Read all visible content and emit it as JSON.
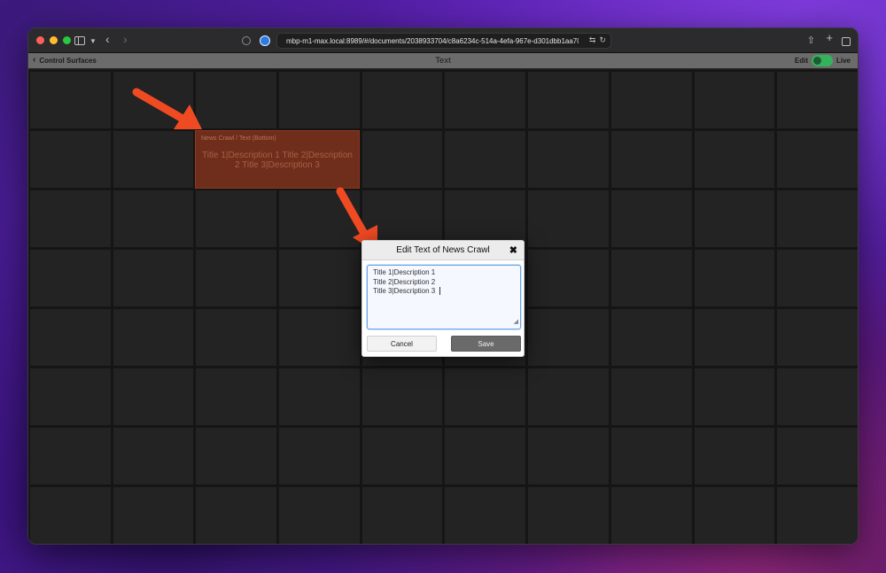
{
  "browser": {
    "url": "mbp-m1-max.local:8989/#/documents/2038933704/c8a6234c-514a-4efa-967e-d301dbb1aa70/butt"
  },
  "app": {
    "back_label": "Control Surfaces",
    "title": "Text",
    "mode_edit": "Edit",
    "mode_live": "Live",
    "accent_color": "#34b45a"
  },
  "tile": {
    "label": "News Crawl / Text (Bottom)",
    "text": "Title 1|Description 1 Title 2|Description 2 Title 3|Description 3",
    "color": "#6f2e1b"
  },
  "modal": {
    "title": "Edit Text of News Crawl",
    "lines": [
      "Title 1|Description 1",
      "Title 2|Description 2",
      "Title 3|Description 3"
    ],
    "cancel_label": "Cancel",
    "save_label": "Save"
  },
  "annotation": {
    "arrow_color": "#f04a23"
  }
}
